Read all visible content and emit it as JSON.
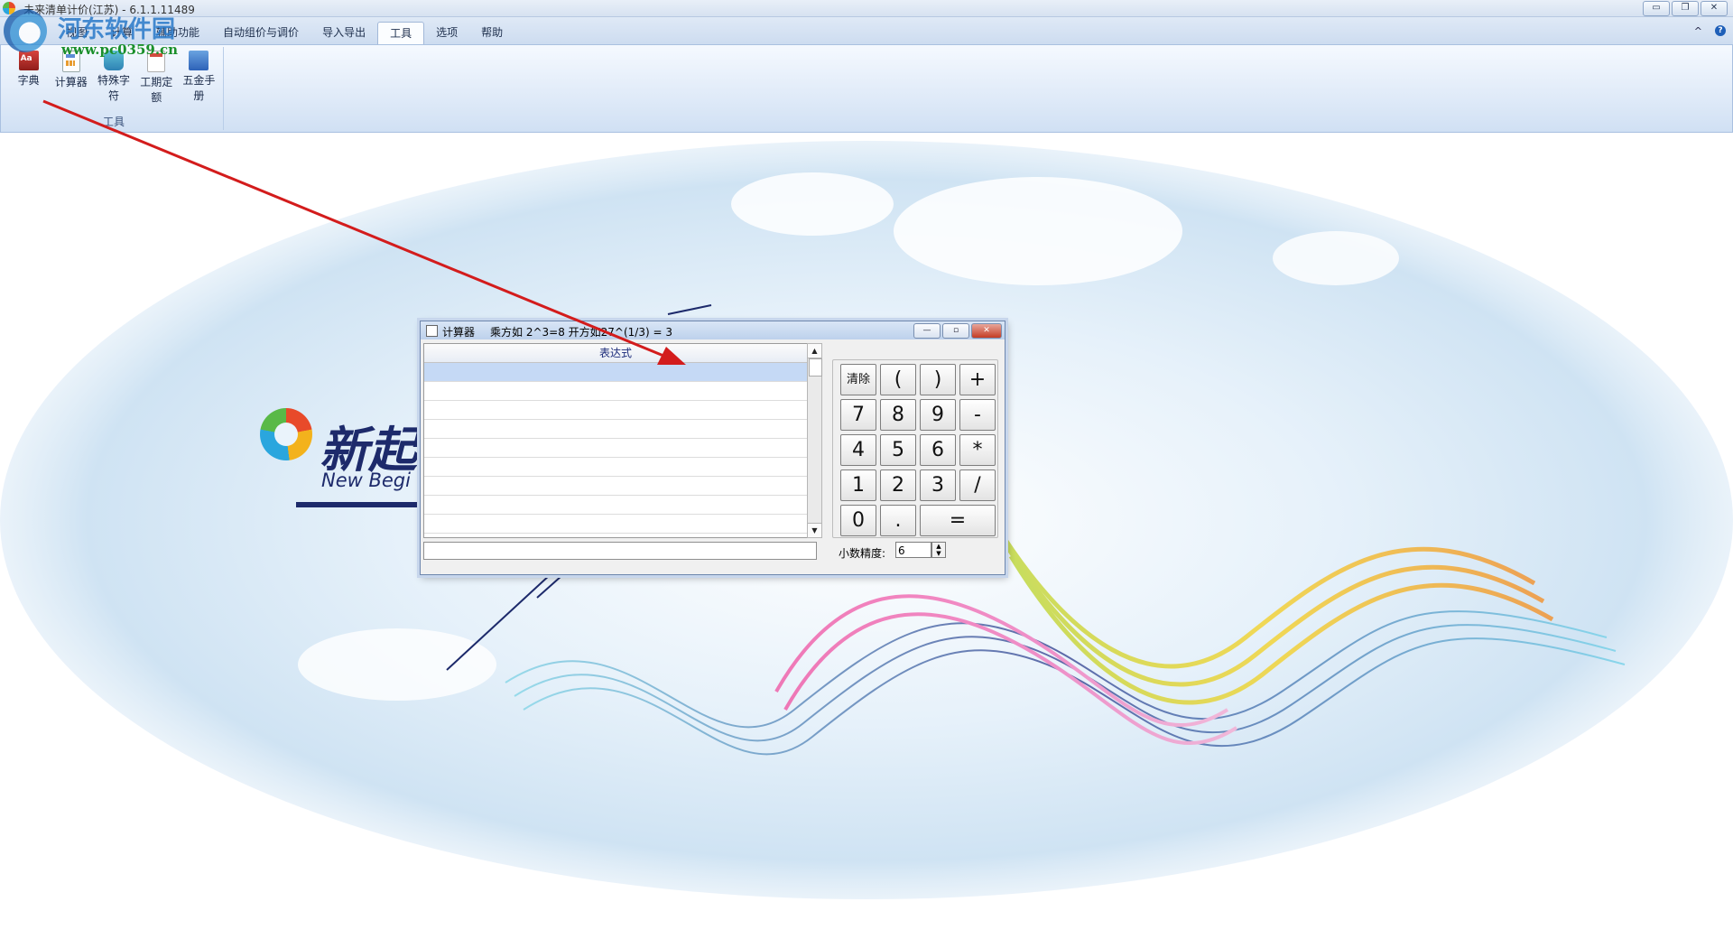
{
  "app": {
    "title": "未来清单计价(江苏) - 6.1.1.11489",
    "window_controls": [
      "▭",
      "❐",
      "✕"
    ]
  },
  "watermark": {
    "name": "河东软件园",
    "url": "www.pc0359.cn"
  },
  "ribbon": {
    "tabs": [
      "视图",
      "计算",
      "辅助功能",
      "自动组价与调价",
      "导入导出",
      "工具",
      "选项",
      "帮助"
    ],
    "active_tab": "工具",
    "collapse_glyph": "^",
    "help_glyph": "?",
    "group": {
      "label": "工具",
      "items": [
        {
          "label": "字典",
          "icon": "dictionary-icon"
        },
        {
          "label": "计算器",
          "icon": "calculator-icon"
        },
        {
          "label": "特殊字符",
          "icon": "special-char-icon"
        },
        {
          "label": "工期定额",
          "icon": "calendar-icon"
        },
        {
          "label": "五金手册",
          "icon": "handbook-icon"
        }
      ]
    }
  },
  "background": {
    "brand_name": "新起",
    "brand_en": "New Begi"
  },
  "calculator": {
    "title": "计算器",
    "hint": "乘方如 2^3=8 开方如27^(1/3) = 3",
    "controls": [
      "—",
      "▫",
      "✕"
    ],
    "table_header": "表达式",
    "keys": [
      "清除",
      "(",
      ")",
      "+",
      "7",
      "8",
      "9",
      "-",
      "4",
      "5",
      "6",
      "*",
      "1",
      "2",
      "3",
      "/",
      "0",
      ".",
      "="
    ],
    "precision_label": "小数精度:",
    "precision_value": "6",
    "spin_glyphs": [
      "▲",
      "▼"
    ],
    "scroll_glyphs": [
      "▲",
      "▼"
    ]
  },
  "colors": {
    "ribbon_blue": "#cddcf0",
    "annotation_arrow": "#d31c1c",
    "brand_navy": "#1d2a6b"
  }
}
